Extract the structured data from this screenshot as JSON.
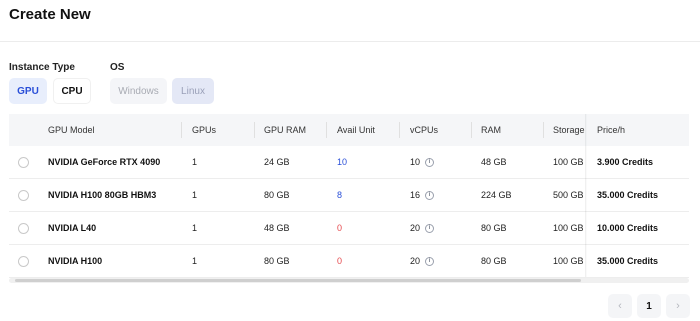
{
  "page": {
    "title": "Create New"
  },
  "instance_type": {
    "label": "Instance Type",
    "options": [
      "GPU",
      "CPU"
    ],
    "selected": "GPU"
  },
  "os": {
    "label": "OS",
    "options": [
      "Windows",
      "Linux"
    ],
    "selected": "Linux"
  },
  "table": {
    "headers": {
      "gpu_model": "GPU Model",
      "gpus": "GPUs",
      "gpu_ram": "GPU RAM",
      "avail_unit": "Avail Unit",
      "vcpus": "vCPUs",
      "ram": "RAM",
      "storage": "Storage",
      "price": "Price/h"
    },
    "rows": [
      {
        "model": "NVIDIA GeForce RTX 4090",
        "gpus": "1",
        "gpu_ram": "24 GB",
        "avail": "10",
        "vcpus": "10",
        "ram": "48 GB",
        "storage": "100 GB",
        "price": "3.900 Credits"
      },
      {
        "model": "NVIDIA H100 80GB HBM3",
        "gpus": "1",
        "gpu_ram": "80 GB",
        "avail": "8",
        "vcpus": "16",
        "ram": "224 GB",
        "storage": "500 GB",
        "price": "35.000 Credits"
      },
      {
        "model": "NVIDIA L40",
        "gpus": "1",
        "gpu_ram": "48 GB",
        "avail": "0",
        "vcpus": "20",
        "ram": "80 GB",
        "storage": "100 GB",
        "price": "10.000 Credits"
      },
      {
        "model": "NVIDIA H100",
        "gpus": "1",
        "gpu_ram": "80 GB",
        "avail": "0",
        "vcpus": "20",
        "ram": "80 GB",
        "storage": "100 GB",
        "price": "35.000 Credits"
      }
    ]
  },
  "pagination": {
    "prev": "‹",
    "current": "1",
    "next": "›"
  },
  "icons": {
    "info": "info-circle-icon"
  },
  "colors": {
    "accent": "#2a4fd8",
    "zero_avail": "#e5484d"
  }
}
